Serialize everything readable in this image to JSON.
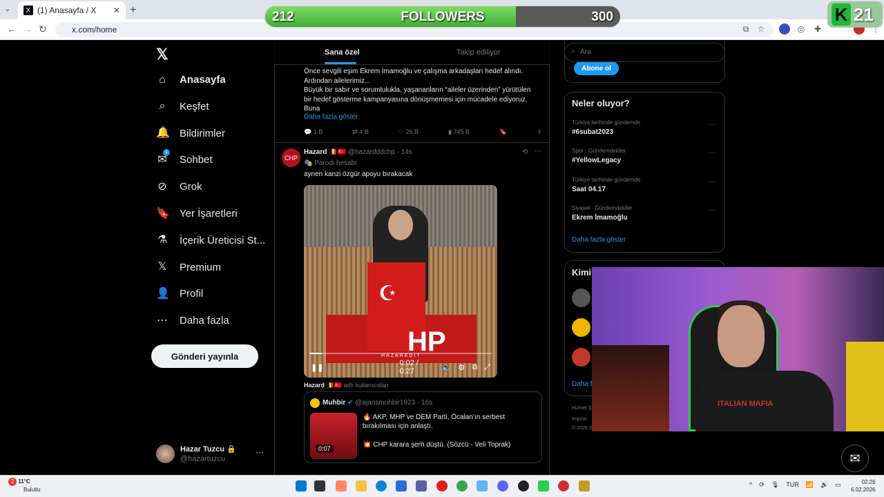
{
  "browser": {
    "tab_title": "(1) Anasayfa / X",
    "url": "x.com/home",
    "new_tab": "+",
    "tab_close": "✕"
  },
  "overlay": {
    "followers_current": "212",
    "followers_label": "FOLLOWERS",
    "followers_goal": "300",
    "followers_progress": 0.7067,
    "badge_number": "21"
  },
  "nav": {
    "items": [
      {
        "label": "Anasayfa",
        "icon": "home-icon"
      },
      {
        "label": "Keşfet",
        "icon": "search-icon"
      },
      {
        "label": "Bildirimler",
        "icon": "bell-icon"
      },
      {
        "label": "Sohbet",
        "icon": "mail-icon",
        "badge": "1"
      },
      {
        "label": "Grok",
        "icon": "grok-icon"
      },
      {
        "label": "Yer İşaretleri",
        "icon": "bookmark-icon"
      },
      {
        "label": "İçerik Üreticisi St...",
        "icon": "flask-icon"
      },
      {
        "label": "Premium",
        "icon": "x-icon"
      },
      {
        "label": "Profil",
        "icon": "person-icon"
      },
      {
        "label": "Daha fazla",
        "icon": "more-circle-icon"
      }
    ],
    "post_button": "Gönderi yayınla",
    "profile": {
      "name": "Hazar Tuzcu 🔒",
      "handle": "@hazartuzcu",
      "more": "···"
    }
  },
  "timeline": {
    "tabs": {
      "for_you": "Sana özel",
      "following": "Takip ediliyor"
    },
    "tweet1": {
      "lines": [
        "Önce sevgili eşim Ekrem İmamoğlu ve çalışma arkadaşları hedef alındı.",
        "Ardından ailelerimiz...",
        "Büyük bir sabır ve sorumlulukla, yaşananların “aileler üzerinden” yürütülen",
        "bir hedef gösterme kampanyasına dönüşmemesi için mücadele ediyoruz.",
        "Buna"
      ],
      "show_more": "Daha fazla göster",
      "replies": "1 B",
      "reposts": "4 B",
      "likes": "26 B",
      "views": "745 B"
    },
    "tweet2": {
      "name": "Hazard",
      "flags": "🇧🇪🇹🇷",
      "handle": "@hazardddchp · 14s",
      "parody": "Parodi hesabı",
      "text": "aynen kanzi özgür apoyu bırakacak",
      "video_time": "0:02 / 0:27",
      "video_progress": 0.07,
      "watermark": "HAZAREDIT",
      "chp": "HP",
      "credit_name": "Hazard",
      "credit_suffix": "adlı kullanıcıdan",
      "quote": {
        "name": "Muhbir",
        "handle": "@ajansmuhbir1923 · 16s",
        "line1": "🔥 AKP, MHP ve DEM Parti, Öcalan’ın serbest",
        "line2": "bırakılması için anlaştı.",
        "line3": "💥 CHP karara şerh düştü. (Sözcü - Veli Toprak)",
        "duration": "0:07"
      }
    }
  },
  "sidebar": {
    "search_placeholder": "Ara",
    "subscribe": "Abone ol",
    "trends_title": "Neler oluyor?",
    "trends": [
      {
        "context": "Türkiye tarihinde gündemde",
        "name": "#6subat2023"
      },
      {
        "context": "Spor · Gündemdekiler",
        "name": "#YellowLegacy"
      },
      {
        "context": "Türkiye tarihinde gündemde",
        "name": "Saat 04.17"
      },
      {
        "context": "Siyaset · Gündemdekiler",
        "name": "Ekrem İmamoğlu"
      }
    ],
    "trends_more": "Daha fazla göster",
    "who_title": "Kimi",
    "who_more": "Daha f",
    "footer": [
      "Hizmet Ş",
      "Imprint",
      "© 2026 X"
    ]
  },
  "webcam": {
    "shirt_text": "ITALIAN MAFIA"
  },
  "taskbar": {
    "temp": "11°C",
    "weather": "Bulutlu",
    "weather_badge": "2",
    "lang": "TUR",
    "time": "02:26",
    "date": "6.02.2026"
  },
  "colors": {
    "accent": "#1d9bf0",
    "progress_green": "#3fae32"
  }
}
